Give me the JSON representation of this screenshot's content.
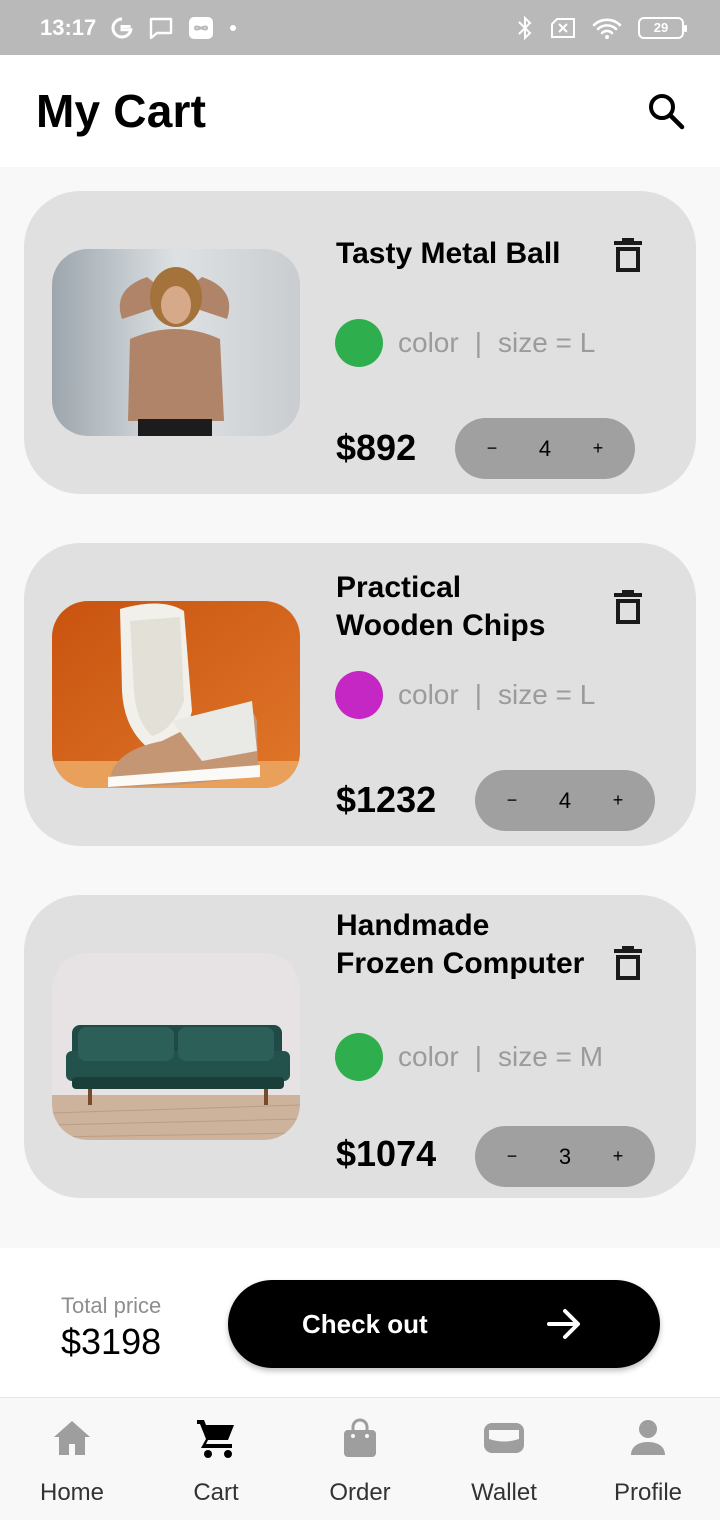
{
  "status_bar": {
    "time": "13:17",
    "battery": "29",
    "icons": [
      "google-icon",
      "message-icon",
      "infinity-icon",
      "bluetooth-icon",
      "sim-off-icon",
      "wifi-icon",
      "battery-icon"
    ]
  },
  "header": {
    "title": "My Cart",
    "search_icon": "search-icon"
  },
  "cart": {
    "items": [
      {
        "title": "Tasty Metal Ball",
        "color_label": "color",
        "separator": "|",
        "size_label": "size = L",
        "swatch_color": "#2fae4e",
        "price": "$892",
        "quantity": "4",
        "minus": "−",
        "plus": "+",
        "image": "woman-in-sweater-photo"
      },
      {
        "title": "Practical Wooden Chips",
        "color_label": "color",
        "separator": "|",
        "size_label": "size = L",
        "swatch_color": "#c427c4",
        "price": "$1232",
        "quantity": "4",
        "minus": "−",
        "plus": "+",
        "image": "sneakers-photo"
      },
      {
        "title": "Handmade Frozen Computer",
        "color_label": "color",
        "separator": "|",
        "size_label": "size = M",
        "swatch_color": "#2fae4e",
        "price": "$1074",
        "quantity": "3",
        "minus": "−",
        "plus": "+",
        "image": "green-sofa-photo"
      }
    ]
  },
  "checkout": {
    "total_label": "Total price",
    "total_value": "$3198",
    "button_label": "Check out",
    "button_icon": "arrow-right-icon"
  },
  "bottom_nav": {
    "items": [
      {
        "label": "Home",
        "icon": "home-icon",
        "active": false
      },
      {
        "label": "Cart",
        "icon": "cart-icon",
        "active": true
      },
      {
        "label": "Order",
        "icon": "bag-icon",
        "active": false
      },
      {
        "label": "Wallet",
        "icon": "wallet-icon",
        "active": false
      },
      {
        "label": "Profile",
        "icon": "person-icon",
        "active": false
      }
    ],
    "active_color": "#000000",
    "inactive_color": "#9e9e9e"
  }
}
